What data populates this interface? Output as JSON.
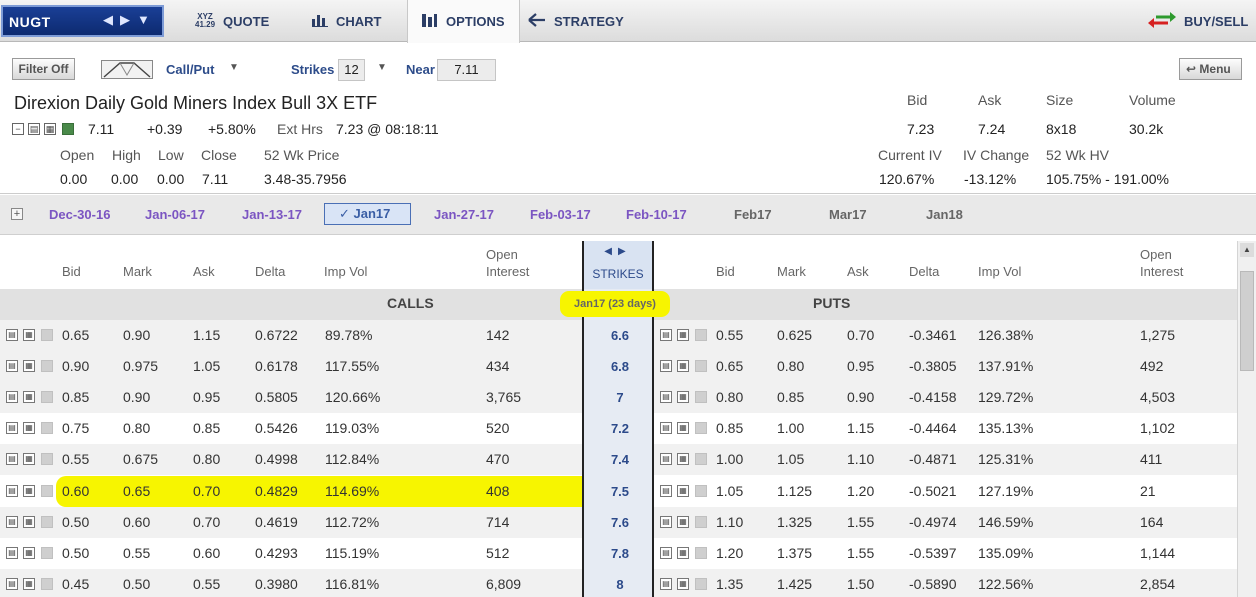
{
  "symbol": {
    "ticker": "NUGT"
  },
  "nav": {
    "quote": "QUOTE",
    "quote_icon_top": "XYZ",
    "quote_icon_bottom": "41.29",
    "chart": "CHART",
    "options": "OPTIONS",
    "strategy": "STRATEGY",
    "buysell": "BUY/SELL"
  },
  "toolbar": {
    "filter": "Filter Off",
    "callput": "Call/Put",
    "strikes_label": "Strikes",
    "strikes_value": "12",
    "near_label": "Near",
    "near_value": "7.11",
    "menu": "Menu"
  },
  "quote": {
    "name": "Direxion Daily Gold Miners Index Bull 3X ETF",
    "last": "7.11",
    "change": "+0.39",
    "change_pct": "+5.80%",
    "ext_label": "Ext Hrs",
    "ext_value": "7.23 @ 08:18:11",
    "labels": {
      "open": "Open",
      "high": "High",
      "low": "Low",
      "close": "Close",
      "wk52": "52 Wk Price",
      "bid": "Bid",
      "ask": "Ask",
      "size": "Size",
      "volume": "Volume",
      "civ": "Current IV",
      "ivc": "IV Change",
      "hv": "52 Wk HV"
    },
    "open": "0.00",
    "high": "0.00",
    "low": "0.00",
    "close": "7.11",
    "wk52": "3.48-35.7956",
    "bid": "7.23",
    "ask": "7.24",
    "size": "8x18",
    "volume": "30.2k",
    "civ": "120.67%",
    "ivc": "-13.12%",
    "hv": "105.75% - 191.00%"
  },
  "expirations": [
    "Dec-30-16",
    "Jan-06-17",
    "Jan-13-17",
    "Jan17",
    "Jan-27-17",
    "Feb-03-17",
    "Feb-10-17",
    "Feb17",
    "Mar17",
    "Jan18"
  ],
  "expiration_selected": "Jan17",
  "chain": {
    "headers": {
      "bid": "Bid",
      "mark": "Mark",
      "ask": "Ask",
      "delta": "Delta",
      "impvol": "Imp Vol",
      "oi_top": "Open",
      "oi_bottom": "Interest",
      "strikes": "STRIKES"
    },
    "calls_title": "CALLS",
    "puts_title": "PUTS",
    "expiry_pill": "Jan17    (23 days)",
    "rows": [
      {
        "strike": "6.6",
        "call": [
          "0.65",
          "0.90",
          "1.15",
          "0.6722",
          "89.78%",
          "142"
        ],
        "put": [
          "0.55",
          "0.625",
          "0.70",
          "-0.3461",
          "126.38%",
          "1,275"
        ]
      },
      {
        "strike": "6.8",
        "call": [
          "0.90",
          "0.975",
          "1.05",
          "0.6178",
          "117.55%",
          "434"
        ],
        "put": [
          "0.65",
          "0.80",
          "0.95",
          "-0.3805",
          "137.91%",
          "492"
        ]
      },
      {
        "strike": "7",
        "call": [
          "0.85",
          "0.90",
          "0.95",
          "0.5805",
          "120.66%",
          "3,765"
        ],
        "put": [
          "0.80",
          "0.85",
          "0.90",
          "-0.4158",
          "129.72%",
          "4,503"
        ]
      },
      {
        "strike": "7.2",
        "call": [
          "0.75",
          "0.80",
          "0.85",
          "0.5426",
          "119.03%",
          "520"
        ],
        "put": [
          "0.85",
          "1.00",
          "1.15",
          "-0.4464",
          "135.13%",
          "1,102"
        ]
      },
      {
        "strike": "7.4",
        "call": [
          "0.55",
          "0.675",
          "0.80",
          "0.4998",
          "112.84%",
          "470"
        ],
        "put": [
          "1.00",
          "1.05",
          "1.10",
          "-0.4871",
          "125.31%",
          "411"
        ]
      },
      {
        "strike": "7.5",
        "call": [
          "0.60",
          "0.65",
          "0.70",
          "0.4829",
          "114.69%",
          "408"
        ],
        "put": [
          "1.05",
          "1.125",
          "1.20",
          "-0.5021",
          "127.19%",
          "21"
        ]
      },
      {
        "strike": "7.6",
        "call": [
          "0.50",
          "0.60",
          "0.70",
          "0.4619",
          "112.72%",
          "714"
        ],
        "put": [
          "1.10",
          "1.325",
          "1.55",
          "-0.4974",
          "146.59%",
          "164"
        ]
      },
      {
        "strike": "7.8",
        "call": [
          "0.50",
          "0.55",
          "0.60",
          "0.4293",
          "115.19%",
          "512"
        ],
        "put": [
          "1.20",
          "1.375",
          "1.55",
          "-0.5397",
          "135.09%",
          "1,144"
        ]
      },
      {
        "strike": "8",
        "call": [
          "0.45",
          "0.50",
          "0.55",
          "0.3980",
          "116.81%",
          "6,809"
        ],
        "put": [
          "1.35",
          "1.425",
          "1.50",
          "-0.5890",
          "122.56%",
          "2,854"
        ]
      }
    ]
  },
  "highlight_strike": "7.5",
  "colors": {
    "highlight": "#f7f500",
    "nav_text": "#2c3e66",
    "expiry_link": "#7b55c2"
  }
}
